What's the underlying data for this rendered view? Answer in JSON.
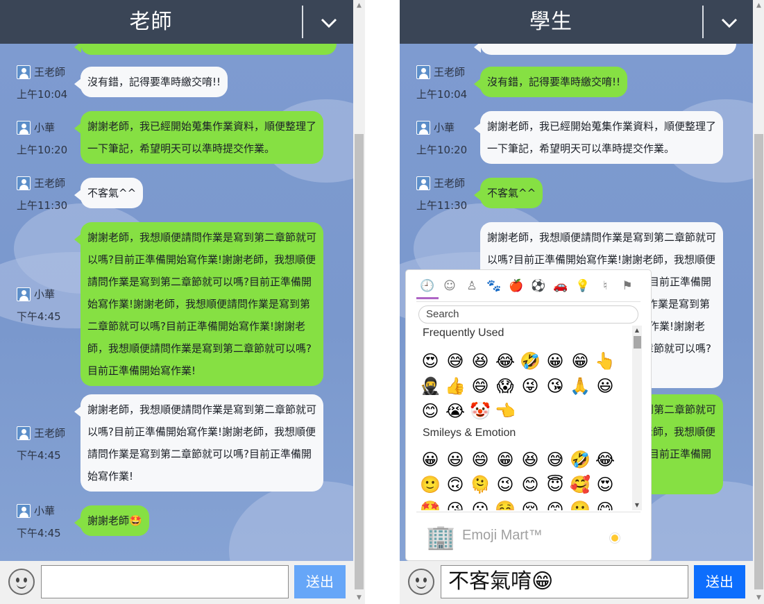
{
  "left": {
    "header_title": "老師",
    "messages": [
      {
        "sender": "王老師",
        "time": "上午10:04",
        "text": "沒有錯，記得要準時繳交唷!!"
      },
      {
        "sender": "小華",
        "time": "上午10:20",
        "text_lines": [
          "謝謝老師，我已經開始蒐集作業資料，順便整理了",
          "一下筆記，希望明天可以準時提交作業。"
        ]
      },
      {
        "sender": "王老師",
        "time": "上午11:30",
        "text": "不客氣^^"
      },
      {
        "sender": "小華",
        "time": "下午4:45",
        "text_lines": [
          "謝謝老師，我想順便請問作業是寫到第二章節就可",
          "以嗎?目前正準備開始寫作業!謝謝老師，我想順便",
          "請問作業是寫到第二章節就可以嗎?目前正準備開",
          "始寫作業!謝謝老師，我想順便請問作業是寫到第",
          "二章節就可以嗎?目前正準備開始寫作業!謝謝老",
          "師，我想順便請問作業是寫到第二章節就可以嗎?",
          "目前正準備開始寫作業!"
        ]
      },
      {
        "sender": "王老師",
        "time": "下午4:45",
        "text_lines": [
          "謝謝老師，我想順便請問作業是寫到第二章節就可",
          "以嗎?目前正準備開始寫作業!謝謝老師，我想順便",
          "請問作業是寫到第二章節就可以嗎?目前正準備開",
          "始寫作業!"
        ]
      },
      {
        "sender": "小華",
        "time": "下午4:45",
        "text": "謝謝老師🤩"
      }
    ],
    "input_value": "",
    "send_label": "送出",
    "colors": {
      "send": "#66a6f8"
    }
  },
  "right": {
    "header_title": "學生",
    "messages": [
      {
        "sender": "王老師",
        "time": "上午10:04",
        "text": "沒有錯，記得要準時繳交唷!!"
      },
      {
        "sender": "小華",
        "time": "上午10:20",
        "text_lines": [
          "謝謝老師，我已經開始蒐集作業資料，順便整理了",
          "一下筆記，希望明天可以準時提交作業。"
        ]
      },
      {
        "sender": "王老師",
        "time": "上午11:30",
        "text": "不客氣^^"
      },
      {
        "partial_lines": [
          "謝謝老師，我想順便請問作業是寫到第二章節就可",
          "以嗎?目前正準備開始寫作業!謝謝老師，我想順便",
          "請問作業是寫到第二章節就可以嗎?目前正準備開",
          "始寫作業!謝謝老師，我想順便請問作業是寫到第",
          "二章節就可以嗎?目前正準備開始寫作業!謝謝老",
          "師，我想順便請問作業是寫到第二章節就可以嗎?"
        ]
      },
      {
        "partial_lines": [
          "謝謝老師，我想順便請問作業是寫到第二章節就可",
          "以嗎?目前正準備開始寫作業!謝謝老師，我想順便",
          "請問作業是寫到第二章節就可以嗎?目前正準備開"
        ]
      }
    ],
    "input_value": "不客氣唷😁",
    "send_label": "送出",
    "colors": {
      "send": "#0d6efd"
    }
  },
  "emoji_picker": {
    "search_placeholder": "Search",
    "sections": [
      {
        "title": "Frequently Used",
        "emojis": [
          "😍",
          "😅",
          "😆",
          "😂",
          "🤣",
          "😀",
          "😁",
          "👆",
          "🥷",
          "👍",
          "😄",
          "😱",
          "😜",
          "😘",
          "🙏",
          "😃",
          "😊",
          "😭",
          "🤡",
          "👈"
        ]
      },
      {
        "title": "Smileys & Emotion",
        "emojis": [
          "😀",
          "😃",
          "😄",
          "😁",
          "😆",
          "😅",
          "🤣",
          "😂",
          "🙂",
          "🙃",
          "🫠",
          "😉",
          "😊",
          "😇",
          "🥰",
          "😍",
          "🤩",
          "😘",
          "😗",
          "☺️",
          "😚",
          "😙",
          "🥲",
          "😋"
        ]
      }
    ],
    "categories": [
      "recent-icon",
      "smiley-icon",
      "people-icon",
      "animal-icon",
      "food-icon",
      "activity-icon",
      "travel-icon",
      "objects-icon",
      "symbols-icon",
      "flags-icon"
    ],
    "preview_name": "Emoji Mart™",
    "preview_logo": "🏢"
  }
}
